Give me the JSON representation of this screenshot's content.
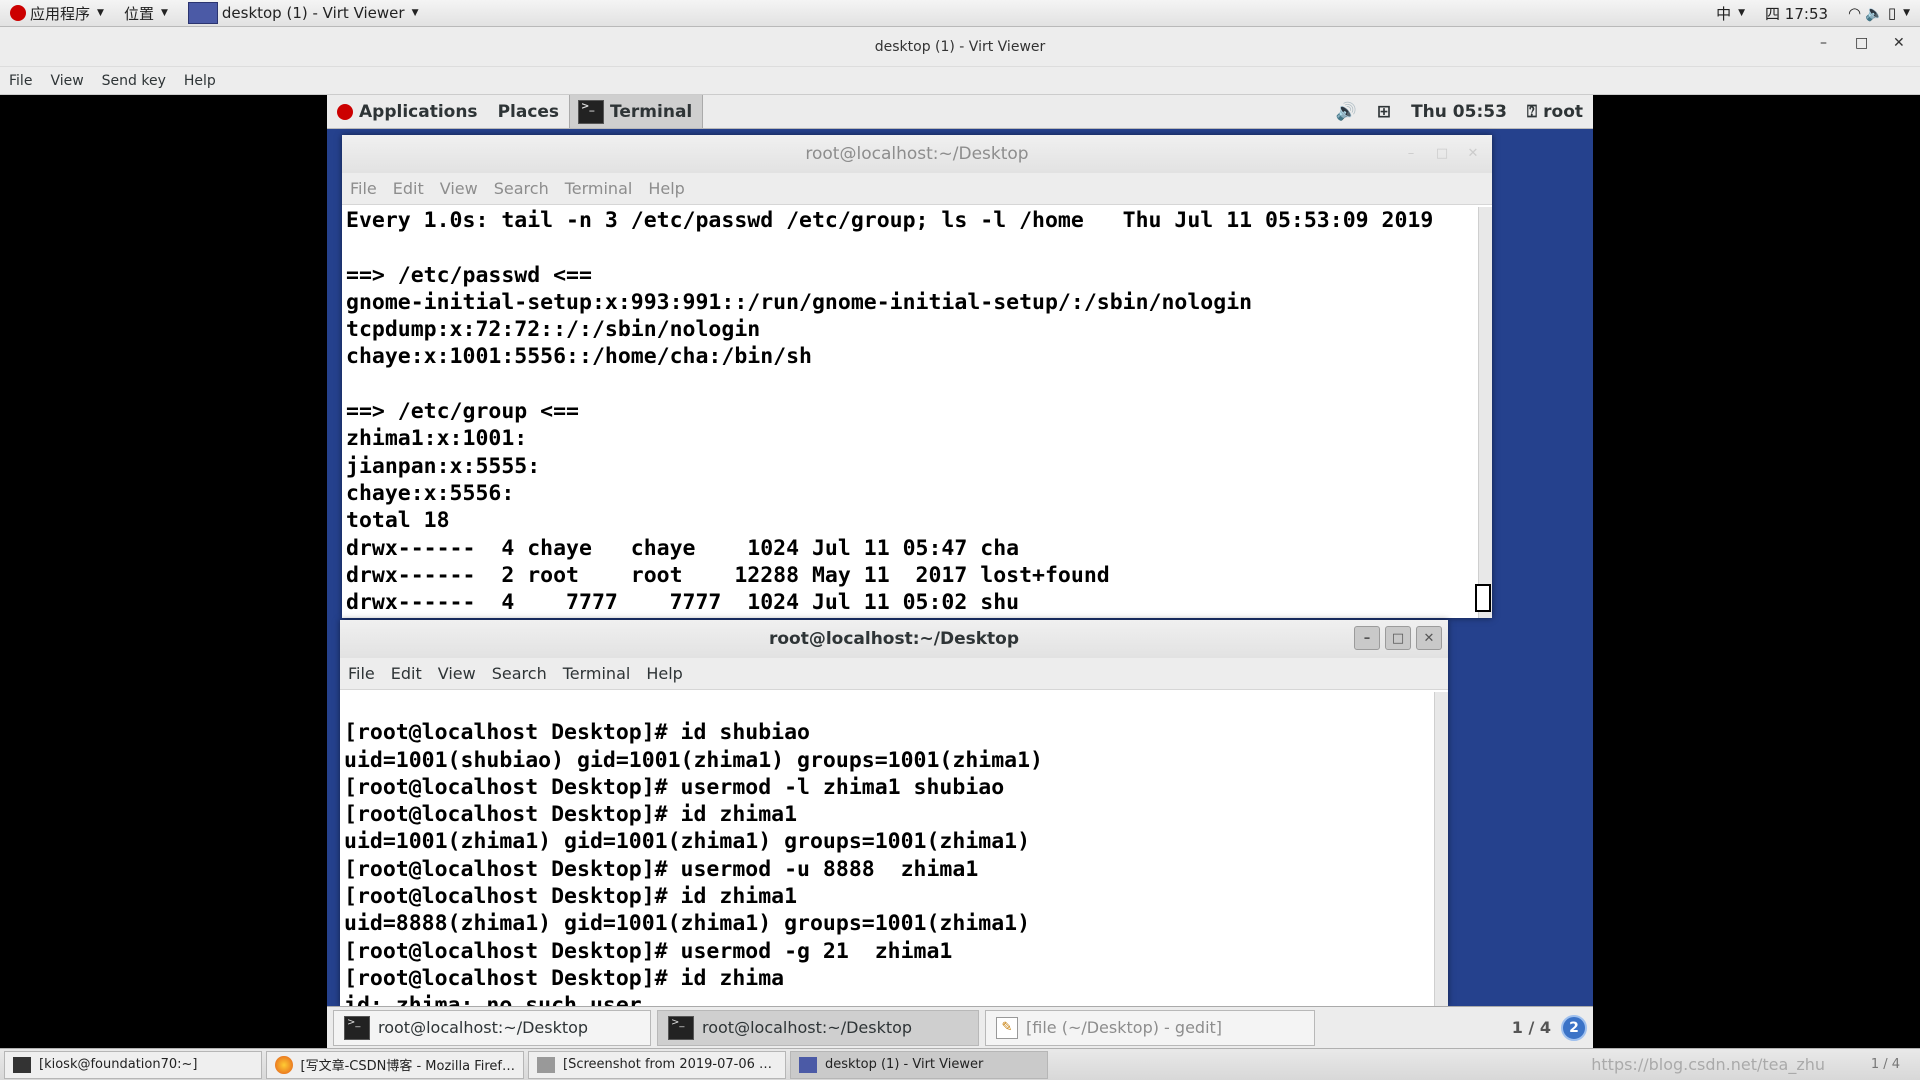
{
  "host_panel": {
    "apps_label": "应用程序",
    "places_label": "位置",
    "window_label": "desktop (1) - Virt Viewer",
    "input_method": "中",
    "clock": "四 17:53"
  },
  "viewer": {
    "title": "desktop (1) - Virt Viewer",
    "menu": [
      "File",
      "View",
      "Send key",
      "Help"
    ]
  },
  "guest_panel": {
    "applications": "Applications",
    "places": "Places",
    "terminal": "Terminal",
    "clock": "Thu 05:53",
    "user": "root"
  },
  "terminal_top": {
    "title": "root@localhost:~/Desktop",
    "menu": [
      "File",
      "Edit",
      "View",
      "Search",
      "Terminal",
      "Help"
    ],
    "lines": [
      "Every 1.0s: tail -n 3 /etc/passwd /etc/group; ls -l /home   Thu Jul 11 05:53:09 2019",
      "",
      "==> /etc/passwd <==",
      "gnome-initial-setup:x:993:991::/run/gnome-initial-setup/:/sbin/nologin",
      "tcpdump:x:72:72::/:/sbin/nologin",
      "chaye:x:1001:5556::/home/cha:/bin/sh",
      "",
      "==> /etc/group <==",
      "zhima1:x:1001:",
      "jianpan:x:5555:",
      "chaye:x:5556:",
      "total 18",
      "drwx------  4 chaye   chaye    1024 Jul 11 05:47 cha",
      "drwx------  2 root    root    12288 May 11  2017 lost+found",
      "drwx------  4    7777    7777  1024 Jul 11 05:02 shu"
    ]
  },
  "terminal_bottom": {
    "title": "root@localhost:~/Desktop",
    "menu": [
      "File",
      "Edit",
      "View",
      "Search",
      "Terminal",
      "Help"
    ],
    "lines": [
      "",
      "[root@localhost Desktop]# id shubiao",
      "uid=1001(shubiao) gid=1001(zhima1) groups=1001(zhima1)",
      "[root@localhost Desktop]# usermod -l zhima1 shubiao",
      "[root@localhost Desktop]# id zhima1",
      "uid=1001(zhima1) gid=1001(zhima1) groups=1001(zhima1)",
      "[root@localhost Desktop]# usermod -u 8888  zhima1",
      "[root@localhost Desktop]# id zhima1",
      "uid=8888(zhima1) gid=1001(zhima1) groups=1001(zhima1)",
      "[root@localhost Desktop]# usermod -g 21  zhima1",
      "[root@localhost Desktop]# id zhima",
      "id: zhima: no such user"
    ]
  },
  "guest_taskbar": {
    "tasks": [
      "root@localhost:~/Desktop",
      "root@localhost:~/Desktop",
      "[file (~/Desktop) - gedit]"
    ],
    "pager": "1 / 4",
    "badge": "2"
  },
  "host_taskbar": {
    "tasks": [
      "[kiosk@foundation70:~]",
      "[写文章-CSDN博客 - Mozilla Firef…",
      "[Screenshot from 2019-07-06 …",
      "desktop (1) - Virt Viewer"
    ],
    "pager": "1 / 4",
    "watermark": "https://blog.csdn.net/tea_zhu"
  }
}
